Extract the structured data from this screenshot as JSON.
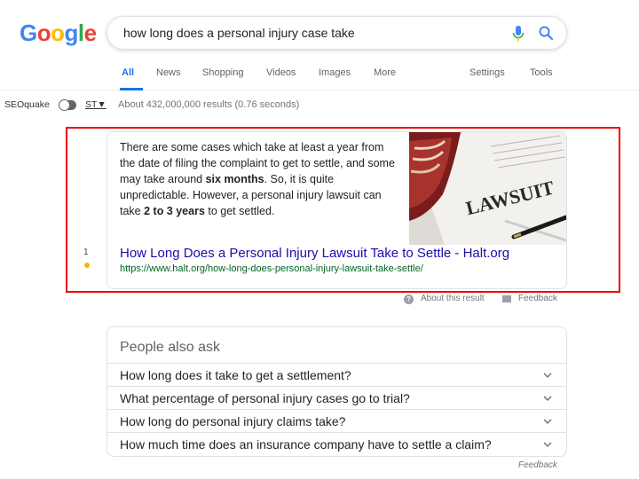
{
  "logo": {
    "letters": [
      "G",
      "o",
      "o",
      "g",
      "l",
      "e"
    ]
  },
  "search": {
    "query": "how long does a personal injury case take"
  },
  "tabs": [
    {
      "label": "All",
      "active": true
    },
    {
      "label": "News"
    },
    {
      "label": "Shopping"
    },
    {
      "label": "Videos"
    },
    {
      "label": "Images"
    },
    {
      "label": "More"
    },
    {
      "label": "Settings"
    },
    {
      "label": "Tools"
    }
  ],
  "seoquake": {
    "label": "SEOquake",
    "st_label": "ST▼"
  },
  "stats": "About 432,000,000 results (0.76 seconds)",
  "snippet": {
    "text_1": "There are some cases which take at least a year from the date of filing the complaint to get to settle, and some may take around ",
    "bold_1": "six months",
    "text_2": ". So, it is quite unpredictable. However, a personal injury lawsuit can take ",
    "bold_2": "2 to 3 years",
    "text_3": " to get settled.",
    "image_text": "LAWSUIT",
    "title": "How Long Does a Personal Injury Lawsuit Take to Settle - Halt.org",
    "url": "https://www.halt.org/how-long-does-personal-injury-lawsuit-take-settle/",
    "rank": "1"
  },
  "about": {
    "about_label": "About this result",
    "feedback_label": "Feedback"
  },
  "paa": {
    "title": "People also ask",
    "questions": [
      "How long does it take to get a settlement?",
      "What percentage of personal injury cases go to trial?",
      "How long do personal injury claims take?",
      "How much time does an insurance company have to settle a claim?"
    ],
    "feedback": "Feedback"
  },
  "colors": {
    "link": "#1a0dab",
    "url": "#006621",
    "accent": "#1a73e8",
    "highlight": "#ee0000",
    "rank_dot": "#f4b400"
  }
}
